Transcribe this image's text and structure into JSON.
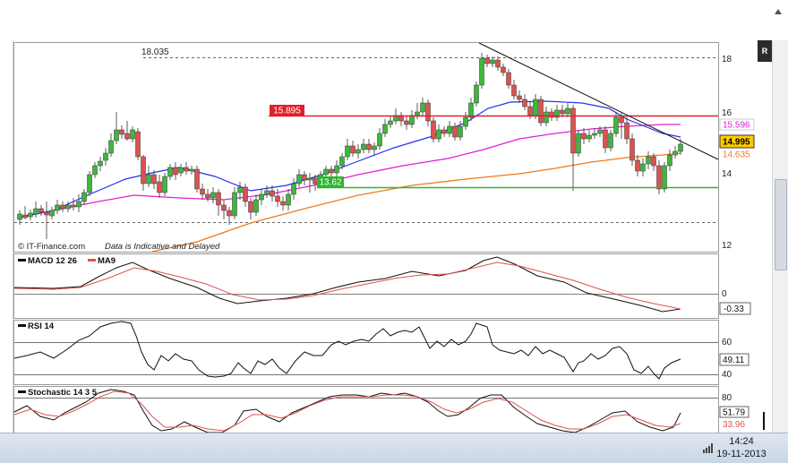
{
  "branding": {
    "text": "© IT-Finance.com",
    "disclaimer": "Data is Indicative and Delayed"
  },
  "main_chart": {
    "price_axis_labels": [
      "18",
      "16",
      "14",
      "12"
    ],
    "labels": {
      "top_level": "18.035",
      "resistance": "15.895",
      "support": "13.62"
    },
    "badges": {
      "ma_pink": "15.596",
      "last_price": "14.995",
      "ma_orange": "14.635"
    },
    "colors": {
      "resistance": "#e0202a",
      "support": "#2fb52f",
      "bull": "#3cb83c",
      "bear": "#d9534f",
      "ma_blue": "#2233ee",
      "ma_pink": "#e020d0",
      "ma_orange": "#f07a1a",
      "trend": "#111111",
      "last_price_bg": "#ffcc00"
    }
  },
  "macd_panel": {
    "legend": [
      {
        "label": "MACD 12 26",
        "color": "#111111"
      },
      {
        "label": "MA9",
        "color": "#e05050"
      }
    ],
    "axis_labels": [
      "0"
    ],
    "value": "-0.33"
  },
  "rsi_panel": {
    "legend": [
      {
        "label": "RSI 14",
        "color": "#111111"
      }
    ],
    "axis_labels": [
      "60",
      "40"
    ],
    "value": "49.11"
  },
  "stochastic_panel": {
    "legend": [
      {
        "label": "Stochastic 14 3 5",
        "color": "#111111"
      }
    ],
    "axis_labels": [
      "80"
    ],
    "values": [
      "51.79",
      "33.96"
    ]
  },
  "window_controls": {
    "right_button": "R"
  },
  "taskbar": {
    "time": "14:24",
    "date": "19-11-2013"
  }
}
